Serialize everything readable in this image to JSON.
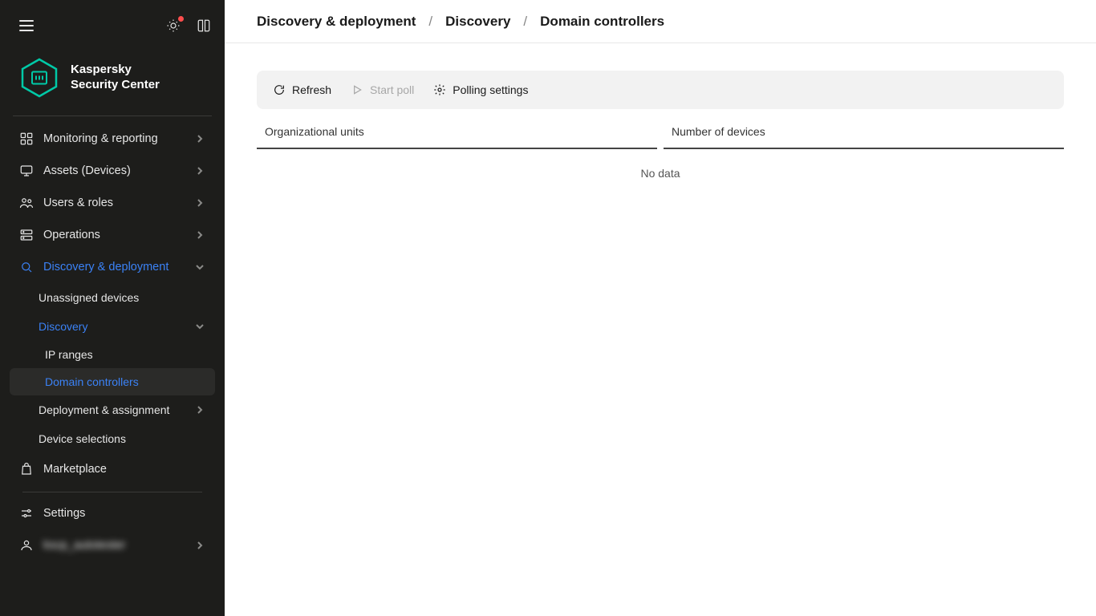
{
  "brand": {
    "line1": "Kaspersky",
    "line2": "Security Center"
  },
  "colors": {
    "accent": "#00a88e",
    "link": "#3b82f6"
  },
  "sidebar": {
    "items": [
      {
        "label": "Monitoring & reporting"
      },
      {
        "label": "Assets (Devices)"
      },
      {
        "label": "Users & roles"
      },
      {
        "label": "Operations"
      },
      {
        "label": "Discovery & deployment"
      },
      {
        "label": "Marketplace"
      }
    ],
    "discovery_children": [
      {
        "label": "Unassigned devices"
      },
      {
        "label": "Discovery"
      },
      {
        "label": "Deployment & assignment"
      },
      {
        "label": "Device selections"
      }
    ],
    "discovery_sub": [
      {
        "label": "IP ranges"
      },
      {
        "label": "Domain controllers"
      }
    ],
    "bottom": [
      {
        "label": "Settings"
      },
      {
        "label": "kscp_autotester"
      }
    ]
  },
  "breadcrumb": {
    "a": "Discovery & deployment",
    "b": "Discovery",
    "c": "Domain controllers",
    "sep": "/"
  },
  "toolbar": {
    "refresh": "Refresh",
    "start_poll": "Start poll",
    "polling_settings": "Polling settings"
  },
  "table": {
    "col_org_units": "Organizational units",
    "col_devices": "Number of devices",
    "no_data": "No data"
  }
}
